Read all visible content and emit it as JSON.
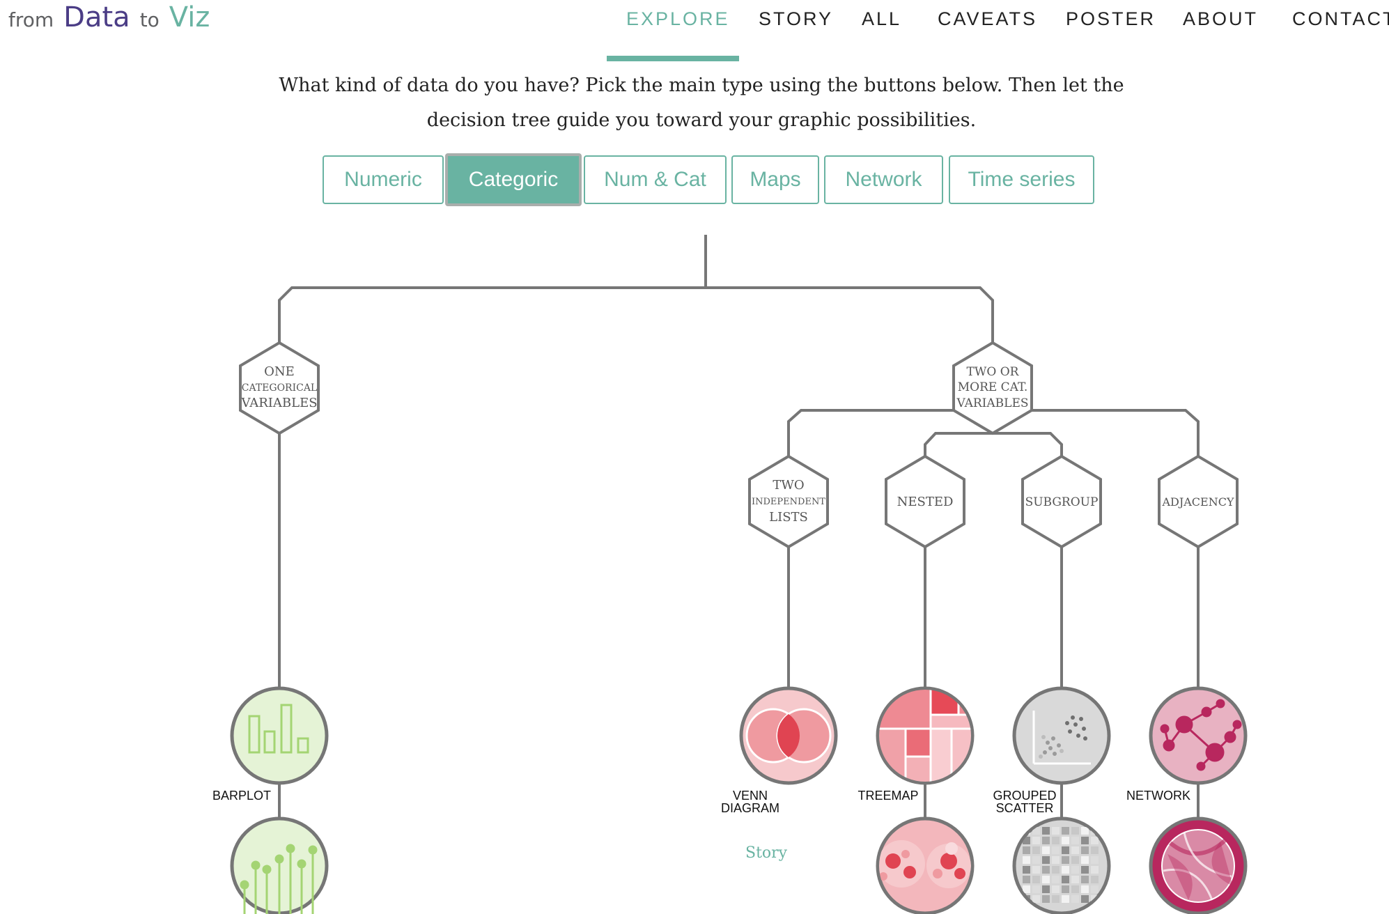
{
  "logo": {
    "from": "from",
    "data": "Data",
    "to": "to",
    "viz": "Viz"
  },
  "nav": [
    "EXPLORE",
    "STORY",
    "ALL",
    "CAVEATS",
    "POSTER",
    "ABOUT",
    "CONTACT"
  ],
  "nav_active": "EXPLORE",
  "intro": {
    "line1": "What kind of data do you have? Pick the main type using the buttons below. Then let the",
    "line2": "decision tree guide you toward your graphic possibilities."
  },
  "types": [
    "Numeric",
    "Categoric",
    "Num & Cat",
    "Maps",
    "Network",
    "Time series"
  ],
  "types_active": "Categoric",
  "tree": {
    "one_cat": [
      "ONE",
      "CATEGORICAL",
      "VARIABLES"
    ],
    "two_cat": [
      "TWO OR",
      "MORE CAT.",
      "VARIABLES"
    ],
    "two_lists": [
      "TWO",
      "INDEPENDENT",
      "LISTS"
    ],
    "nested": [
      "NESTED"
    ],
    "subgroup": [
      "SUBGROUP"
    ],
    "adjacency": [
      "ADJACENCY"
    ]
  },
  "charts": {
    "barplot": "BARPLOT",
    "venn": "VENN\nDIAGRAM",
    "treemap": "TREEMAP",
    "grouped_scatter": "GROUPED\nSCATTER",
    "network": "NETWORK"
  },
  "story_link": "Story",
  "colors": {
    "accent": "#69b3a2",
    "node_stroke": "#767676",
    "green_fill": "#e5f3d6",
    "green_icon": "#a4d473",
    "pink_fill": "#f6c9cc",
    "red": "#e05a64",
    "grey_fill": "#d6d6d6",
    "magenta_fill": "#e8b2c2",
    "magenta": "#b8275e"
  }
}
